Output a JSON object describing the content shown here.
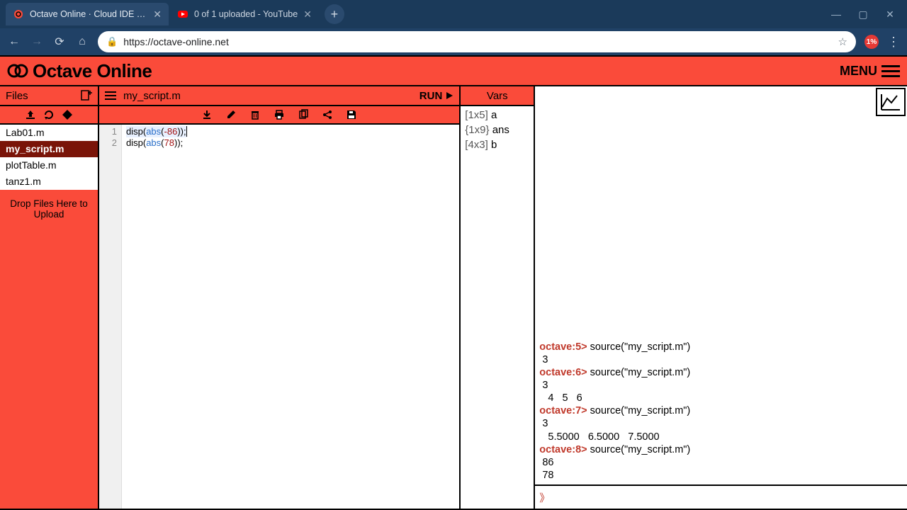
{
  "browser": {
    "tabs": [
      {
        "title": "Octave Online · Cloud IDE compa",
        "active": true,
        "favicon": "octave"
      },
      {
        "title": "0 of 1 uploaded - YouTube",
        "active": false,
        "favicon": "youtube"
      }
    ],
    "url": "https://octave-online.net",
    "badge": "1%"
  },
  "header": {
    "brand": "Octave Online",
    "menu_label": "MENU"
  },
  "files": {
    "header_label": "Files",
    "items": [
      "Lab01.m",
      "my_script.m",
      "plotTable.m",
      "tanz1.m"
    ],
    "active_index": 1,
    "drop_hint": "Drop Files Here to Upload"
  },
  "editor": {
    "current_file": "my_script.m",
    "run_label": "RUN",
    "lines": [
      {
        "n": 1,
        "text": "disp(abs(-86));"
      },
      {
        "n": 2,
        "text": "disp(abs(78));"
      }
    ],
    "cursor_line": 1
  },
  "vars": {
    "header_label": "Vars",
    "items": [
      {
        "dims": "[1x5]",
        "name": "a"
      },
      {
        "dims": "{1x9}",
        "name": "ans"
      },
      {
        "dims": "[4x3]",
        "name": "b"
      }
    ]
  },
  "console": {
    "lines": [
      {
        "prompt": "octave:5>",
        "cmd": " source(\"my_script.m\")"
      },
      {
        "out": " 3"
      },
      {
        "prompt": "octave:6>",
        "cmd": " source(\"my_script.m\")"
      },
      {
        "out": " 3"
      },
      {
        "out": "   4   5   6"
      },
      {
        "prompt": "octave:7>",
        "cmd": " source(\"my_script.m\")"
      },
      {
        "out": " 3"
      },
      {
        "out": "   5.5000   6.5000   7.5000"
      },
      {
        "prompt": "octave:8>",
        "cmd": " source(\"my_script.m\")"
      },
      {
        "out": " 86"
      },
      {
        "out": " 78"
      }
    ],
    "input_prefix": "》",
    "input_value": ""
  }
}
